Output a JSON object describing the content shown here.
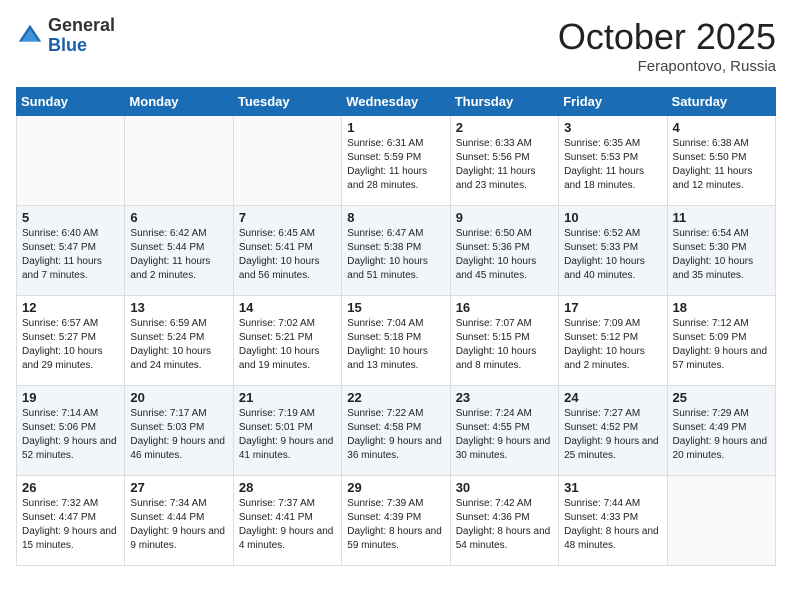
{
  "header": {
    "logo_general": "General",
    "logo_blue": "Blue",
    "month_title": "October 2025",
    "location": "Ferapontovo, Russia"
  },
  "days_of_week": [
    "Sunday",
    "Monday",
    "Tuesday",
    "Wednesday",
    "Thursday",
    "Friday",
    "Saturday"
  ],
  "weeks": [
    [
      {
        "day": "",
        "info": ""
      },
      {
        "day": "",
        "info": ""
      },
      {
        "day": "",
        "info": ""
      },
      {
        "day": "1",
        "info": "Sunrise: 6:31 AM\nSunset: 5:59 PM\nDaylight: 11 hours and 28 minutes."
      },
      {
        "day": "2",
        "info": "Sunrise: 6:33 AM\nSunset: 5:56 PM\nDaylight: 11 hours and 23 minutes."
      },
      {
        "day": "3",
        "info": "Sunrise: 6:35 AM\nSunset: 5:53 PM\nDaylight: 11 hours and 18 minutes."
      },
      {
        "day": "4",
        "info": "Sunrise: 6:38 AM\nSunset: 5:50 PM\nDaylight: 11 hours and 12 minutes."
      }
    ],
    [
      {
        "day": "5",
        "info": "Sunrise: 6:40 AM\nSunset: 5:47 PM\nDaylight: 11 hours and 7 minutes."
      },
      {
        "day": "6",
        "info": "Sunrise: 6:42 AM\nSunset: 5:44 PM\nDaylight: 11 hours and 2 minutes."
      },
      {
        "day": "7",
        "info": "Sunrise: 6:45 AM\nSunset: 5:41 PM\nDaylight: 10 hours and 56 minutes."
      },
      {
        "day": "8",
        "info": "Sunrise: 6:47 AM\nSunset: 5:38 PM\nDaylight: 10 hours and 51 minutes."
      },
      {
        "day": "9",
        "info": "Sunrise: 6:50 AM\nSunset: 5:36 PM\nDaylight: 10 hours and 45 minutes."
      },
      {
        "day": "10",
        "info": "Sunrise: 6:52 AM\nSunset: 5:33 PM\nDaylight: 10 hours and 40 minutes."
      },
      {
        "day": "11",
        "info": "Sunrise: 6:54 AM\nSunset: 5:30 PM\nDaylight: 10 hours and 35 minutes."
      }
    ],
    [
      {
        "day": "12",
        "info": "Sunrise: 6:57 AM\nSunset: 5:27 PM\nDaylight: 10 hours and 29 minutes."
      },
      {
        "day": "13",
        "info": "Sunrise: 6:59 AM\nSunset: 5:24 PM\nDaylight: 10 hours and 24 minutes."
      },
      {
        "day": "14",
        "info": "Sunrise: 7:02 AM\nSunset: 5:21 PM\nDaylight: 10 hours and 19 minutes."
      },
      {
        "day": "15",
        "info": "Sunrise: 7:04 AM\nSunset: 5:18 PM\nDaylight: 10 hours and 13 minutes."
      },
      {
        "day": "16",
        "info": "Sunrise: 7:07 AM\nSunset: 5:15 PM\nDaylight: 10 hours and 8 minutes."
      },
      {
        "day": "17",
        "info": "Sunrise: 7:09 AM\nSunset: 5:12 PM\nDaylight: 10 hours and 2 minutes."
      },
      {
        "day": "18",
        "info": "Sunrise: 7:12 AM\nSunset: 5:09 PM\nDaylight: 9 hours and 57 minutes."
      }
    ],
    [
      {
        "day": "19",
        "info": "Sunrise: 7:14 AM\nSunset: 5:06 PM\nDaylight: 9 hours and 52 minutes."
      },
      {
        "day": "20",
        "info": "Sunrise: 7:17 AM\nSunset: 5:03 PM\nDaylight: 9 hours and 46 minutes."
      },
      {
        "day": "21",
        "info": "Sunrise: 7:19 AM\nSunset: 5:01 PM\nDaylight: 9 hours and 41 minutes."
      },
      {
        "day": "22",
        "info": "Sunrise: 7:22 AM\nSunset: 4:58 PM\nDaylight: 9 hours and 36 minutes."
      },
      {
        "day": "23",
        "info": "Sunrise: 7:24 AM\nSunset: 4:55 PM\nDaylight: 9 hours and 30 minutes."
      },
      {
        "day": "24",
        "info": "Sunrise: 7:27 AM\nSunset: 4:52 PM\nDaylight: 9 hours and 25 minutes."
      },
      {
        "day": "25",
        "info": "Sunrise: 7:29 AM\nSunset: 4:49 PM\nDaylight: 9 hours and 20 minutes."
      }
    ],
    [
      {
        "day": "26",
        "info": "Sunrise: 7:32 AM\nSunset: 4:47 PM\nDaylight: 9 hours and 15 minutes."
      },
      {
        "day": "27",
        "info": "Sunrise: 7:34 AM\nSunset: 4:44 PM\nDaylight: 9 hours and 9 minutes."
      },
      {
        "day": "28",
        "info": "Sunrise: 7:37 AM\nSunset: 4:41 PM\nDaylight: 9 hours and 4 minutes."
      },
      {
        "day": "29",
        "info": "Sunrise: 7:39 AM\nSunset: 4:39 PM\nDaylight: 8 hours and 59 minutes."
      },
      {
        "day": "30",
        "info": "Sunrise: 7:42 AM\nSunset: 4:36 PM\nDaylight: 8 hours and 54 minutes."
      },
      {
        "day": "31",
        "info": "Sunrise: 7:44 AM\nSunset: 4:33 PM\nDaylight: 8 hours and 48 minutes."
      },
      {
        "day": "",
        "info": ""
      }
    ]
  ]
}
